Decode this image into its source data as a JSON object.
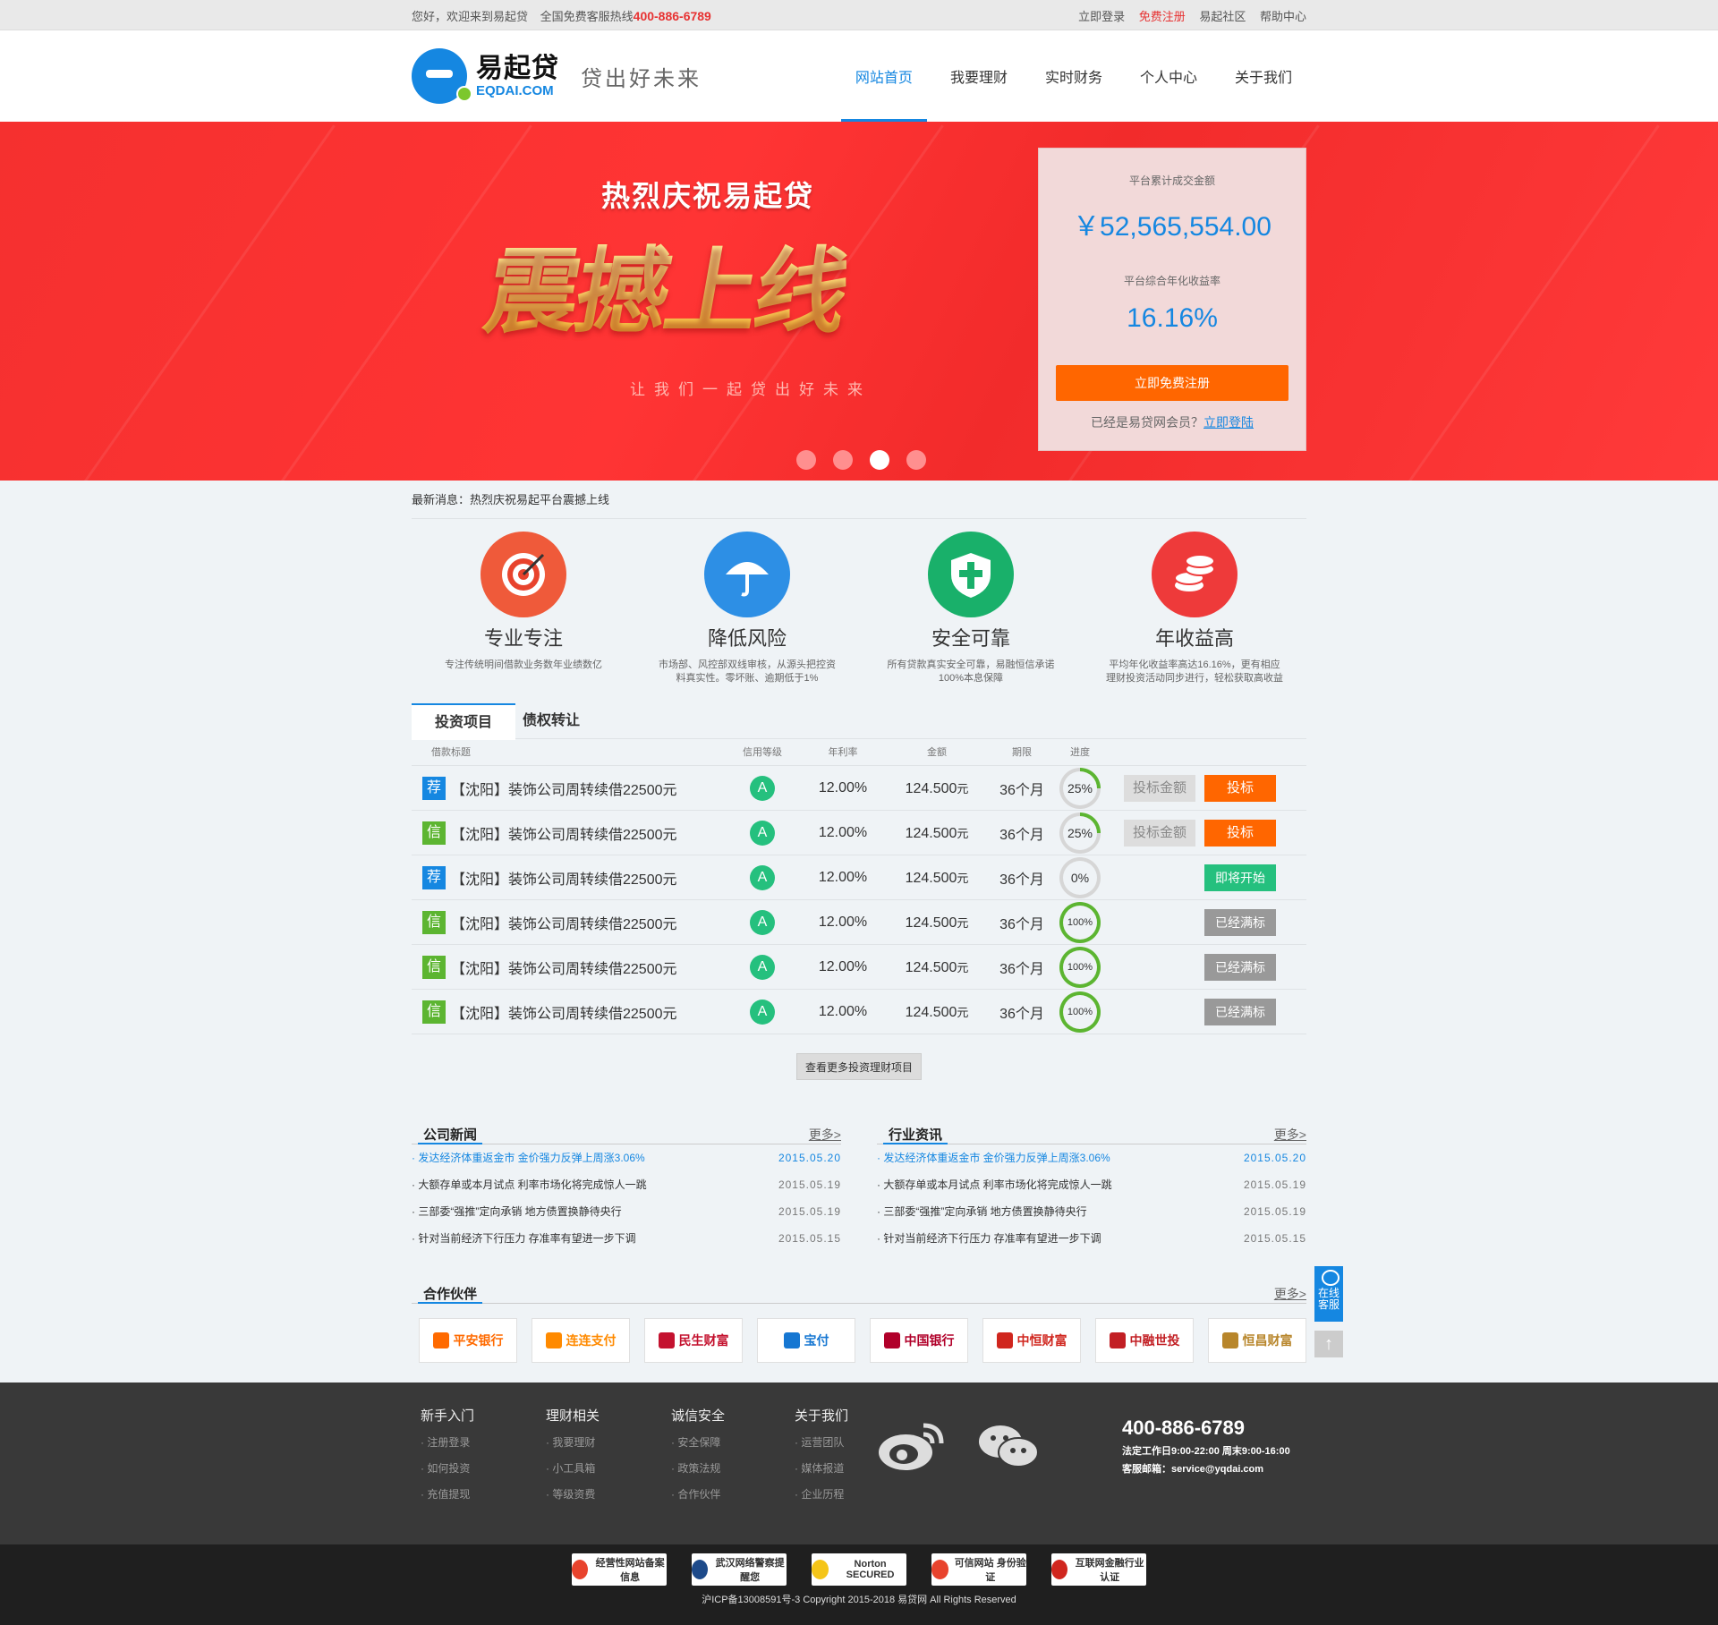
{
  "topbar": {
    "welcome": "您好，欢迎来到易起贷",
    "hotline_label": "全国免费客服热线",
    "hotline": "400-886-6789",
    "links": [
      "立即登录",
      "免费注册",
      "易起社区",
      "帮助中心"
    ]
  },
  "header": {
    "logo_cn": "易起贷",
    "logo_en": "EQDAI.COM",
    "slogan": "贷出好未来",
    "nav": [
      "网站首页",
      "我要理财",
      "实时财务",
      "个人中心",
      "关于我们"
    ]
  },
  "banner": {
    "title": "热烈庆祝易起贷",
    "big": "震撼上线",
    "sub": "让我们一起贷出好未来",
    "stats": {
      "total_label": "平台累计成交金额",
      "total_value": "￥52,565,554.00",
      "rate_label": "平台综合年化收益率",
      "rate_value": "16.16%",
      "register_btn": "立即免费注册",
      "member_text": "已经是易贷网会员？",
      "login_link": "立即登陆"
    }
  },
  "news_ticker": "最新消息：热烈庆祝易起平台震撼上线",
  "features": [
    {
      "title": "专业专注",
      "desc": "专注传统明间借款业务数年业绩数亿",
      "color": "#ef5a3a"
    },
    {
      "title": "降低风险",
      "desc": "市场部、风控部双线审核，从源头把控资料真实性。零坏账、逾期低于1%",
      "color": "#2d8fe5"
    },
    {
      "title": "安全可靠",
      "desc": "所有贷款真实安全可靠，易融恒信承诺100%本息保障",
      "color": "#19b06a"
    },
    {
      "title": "年收益高",
      "desc": "平均年化收益率高达16.16%，更有相应理财投资活动同步进行，轻松获取高收益",
      "color": "#ee3a3a"
    }
  ],
  "tabs": [
    "投资项目",
    "债权转让"
  ],
  "table": {
    "headers": [
      "借款标题",
      "信用等级",
      "年利率",
      "金额",
      "期限",
      "进度"
    ],
    "rows": [
      {
        "tag": "荐",
        "tag_color": "blue",
        "title": "【沈阳】装饰公司周转续借22500元",
        "grade": "A",
        "rate": "12.00%",
        "amount": "124.500",
        "unit": "元",
        "term": "36个月",
        "progress": "25%",
        "progress_value": 25,
        "input": "投标金额",
        "action": "投标",
        "action_style": "orange"
      },
      {
        "tag": "信",
        "tag_color": "green",
        "title": "【沈阳】装饰公司周转续借22500元",
        "grade": "A",
        "rate": "12.00%",
        "amount": "124.500",
        "unit": "元",
        "term": "36个月",
        "progress": "25%",
        "progress_value": 25,
        "input": "投标金额",
        "action": "投标",
        "action_style": "orange"
      },
      {
        "tag": "荐",
        "tag_color": "blue",
        "title": "【沈阳】装饰公司周转续借22500元",
        "grade": "A",
        "rate": "12.00%",
        "amount": "124.500",
        "unit": "元",
        "term": "36个月",
        "progress": "0%",
        "progress_value": 0,
        "input": "",
        "action": "即将开始",
        "action_style": "green"
      },
      {
        "tag": "信",
        "tag_color": "green",
        "title": "【沈阳】装饰公司周转续借22500元",
        "grade": "A",
        "rate": "12.00%",
        "amount": "124.500",
        "unit": "元",
        "term": "36个月",
        "progress": "100%",
        "progress_value": 100,
        "input": "",
        "action": "已经满标",
        "action_style": "gray"
      },
      {
        "tag": "信",
        "tag_color": "green",
        "title": "【沈阳】装饰公司周转续借22500元",
        "grade": "A",
        "rate": "12.00%",
        "amount": "124.500",
        "unit": "元",
        "term": "36个月",
        "progress": "100%",
        "progress_value": 100,
        "input": "",
        "action": "已经满标",
        "action_style": "gray"
      },
      {
        "tag": "信",
        "tag_color": "green",
        "title": "【沈阳】装饰公司周转续借22500元",
        "grade": "A",
        "rate": "12.00%",
        "amount": "124.500",
        "unit": "元",
        "term": "36个月",
        "progress": "100%",
        "progress_value": 100,
        "input": "",
        "action": "已经满标",
        "action_style": "gray"
      }
    ],
    "more_button": "查看更多投资理财项目"
  },
  "news": [
    {
      "title": "公司新闻",
      "more": "更多>",
      "items": [
        {
          "text": "· 发达经济体重返金市  金价强力反弹上周涨3.06%",
          "date": "2015.05.20"
        },
        {
          "text": "· 大额存单或本月试点  利率市场化将完成惊人一跳",
          "date": "2015.05.19"
        },
        {
          "text": "· 三部委“强推”定向承销  地方债置换静待央行",
          "date": "2015.05.19"
        },
        {
          "text": "· 针对当前经济下行压力  存准率有望进一步下调",
          "date": "2015.05.15"
        }
      ]
    },
    {
      "title": "行业资讯",
      "more": "更多>",
      "items": [
        {
          "text": "· 发达经济体重返金市  金价强力反弹上周涨3.06%",
          "date": "2015.05.20"
        },
        {
          "text": "· 大额存单或本月试点  利率市场化将完成惊人一跳",
          "date": "2015.05.19"
        },
        {
          "text": "· 三部委“强推”定向承销  地方债置换静待央行",
          "date": "2015.05.19"
        },
        {
          "text": "· 针对当前经济下行压力  存准率有望进一步下调",
          "date": "2015.05.15"
        }
      ]
    }
  ],
  "partners": {
    "title": "合作伙伴",
    "more": "更多>",
    "logos": [
      {
        "name": "平安银行",
        "color": "#ff6a00"
      },
      {
        "name": "连连支付",
        "color": "#ff8a00"
      },
      {
        "name": "民生财富",
        "color": "#c4122f"
      },
      {
        "name": "宝付",
        "color": "#1677d2"
      },
      {
        "name": "中国银行",
        "color": "#b1002a"
      },
      {
        "name": "中恒财富",
        "color": "#d0261e"
      },
      {
        "name": "中融世投",
        "color": "#c21f24"
      },
      {
        "name": "恒昌财富",
        "color": "#b8862b"
      }
    ]
  },
  "side": {
    "service": "在线客服",
    "top": "↑"
  },
  "footer": {
    "cols": [
      {
        "title": "新手入门",
        "links": [
          "· 注册登录",
          "· 如何投资",
          "· 充值提现"
        ]
      },
      {
        "title": "理财相关",
        "links": [
          "· 我要理财",
          "· 小工具箱",
          "· 等级资费"
        ]
      },
      {
        "title": "诚信安全",
        "links": [
          "· 安全保障",
          "· 政策法规",
          "· 合作伙伴"
        ]
      },
      {
        "title": "关于我们",
        "links": [
          "· 运营团队",
          "· 媒体报道",
          "· 企业历程"
        ]
      }
    ],
    "phone": "400-886-6789",
    "hours": "法定工作日9:00-22:00  周末9:00-16:00",
    "email": "客服邮箱：service@yqdai.com",
    "badges": [
      "经营性网站备案信息",
      "武汉网络警察提醒您",
      "Norton SECURED",
      "可信网站 身份验证",
      "互联网金融行业认证"
    ],
    "copyright": "沪ICP备13008591号-3   Copyright 2015-2018 易贷网 All Rights Reserved"
  }
}
